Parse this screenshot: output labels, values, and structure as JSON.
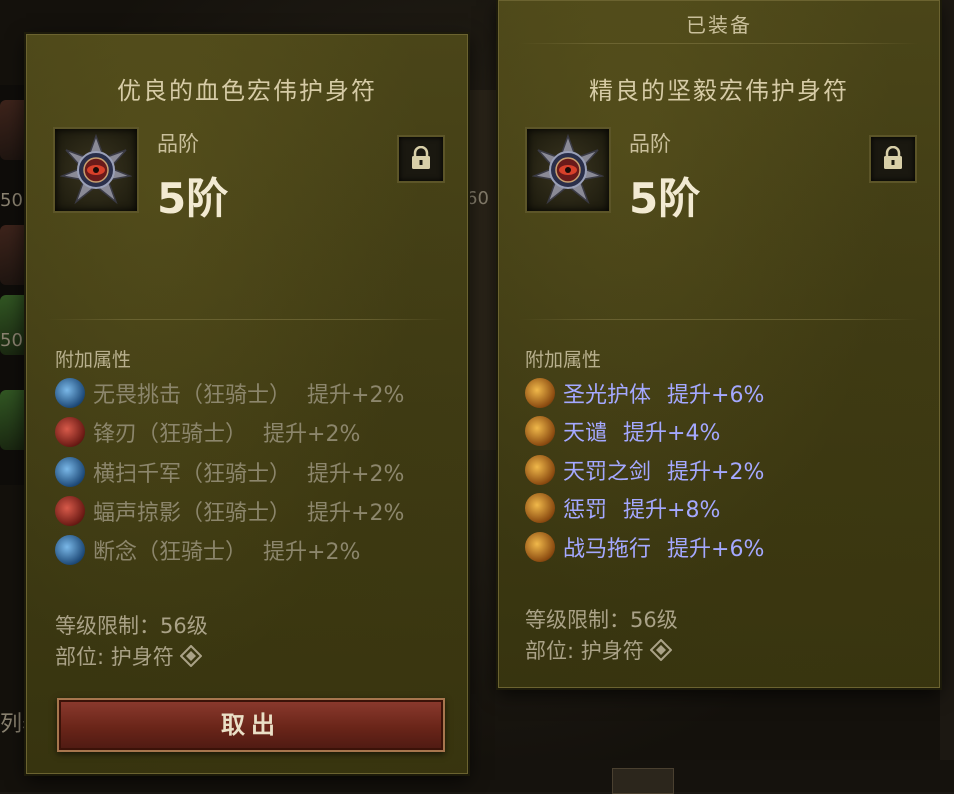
{
  "left_tooltip": {
    "title": "优良的血色宏伟护身符",
    "quality_label": "品阶",
    "quality_value": "5阶",
    "affix_section_label": "附加属性",
    "affixes": [
      {
        "name": "无畏挑击（狂骑士）",
        "bonus": "提升+2%",
        "icon": "lightning-strike-icon",
        "color": "#4a8fc8"
      },
      {
        "name": "锋刃（狂骑士）",
        "bonus": "提升+2%",
        "icon": "blade-icon",
        "color": "#a83434"
      },
      {
        "name": "横扫千军（狂骑士）",
        "bonus": "提升+2%",
        "icon": "sweep-icon",
        "color": "#4a8fc8"
      },
      {
        "name": "蝠声掠影（狂骑士）",
        "bonus": "提升+2%",
        "icon": "bat-shadow-icon",
        "color": "#a83434"
      },
      {
        "name": "断念（狂骑士）",
        "bonus": "提升+2%",
        "icon": "sever-icon",
        "color": "#4a8fc8"
      }
    ],
    "level_requirement": "等级限制：56级",
    "slot": "部位: 护身符",
    "take_out_button": "取出"
  },
  "right_tooltip": {
    "equipped_label": "已装备",
    "title": "精良的坚毅宏伟护身符",
    "quality_label": "品阶",
    "quality_value": "5阶",
    "affix_section_label": "附加属性",
    "affixes": [
      {
        "name": "圣光护体",
        "bonus": "提升+6%",
        "icon": "holy-aura-icon",
        "color": "#c98a2a"
      },
      {
        "name": "天谴",
        "bonus": "提升+4%",
        "icon": "heaven-wrath-icon",
        "color": "#c98a2a"
      },
      {
        "name": "天罚之剑",
        "bonus": "提升+2%",
        "icon": "holy-sword-icon",
        "color": "#c98a2a"
      },
      {
        "name": "惩罚",
        "bonus": "提升+8%",
        "icon": "punish-icon",
        "color": "#c98a2a"
      },
      {
        "name": "战马拖行",
        "bonus": "提升+6%",
        "icon": "warhorse-icon",
        "color": "#c98a2a"
      }
    ],
    "level_requirement": "等级限制：56级",
    "slot": "部位: 护身符"
  },
  "background": {
    "left_number_a": "50",
    "left_number_b": "50",
    "mid_number": "60",
    "left_text": "列表"
  }
}
